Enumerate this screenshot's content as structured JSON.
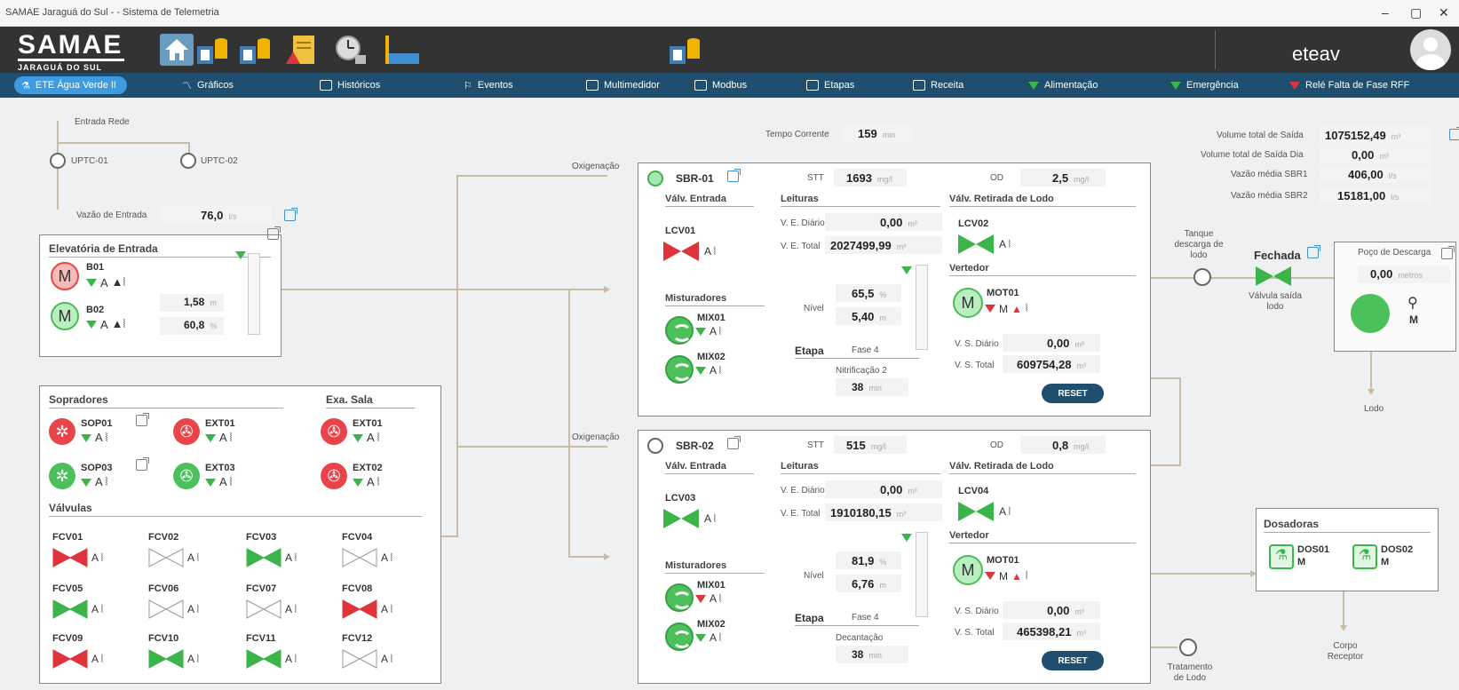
{
  "window": {
    "title": "SAMAE Jaraguá do Sul - - Sistema de Telemetria",
    "min": "–",
    "max": "▢",
    "close": "✕"
  },
  "header": {
    "logo_line1": "SAMAE",
    "logo_line2": "JARAGUÁ DO SUL",
    "user": "eteav"
  },
  "nav": {
    "items": [
      "ETE Água Verde II",
      "Gráficos",
      "Históricos",
      "Eventos",
      "Multimedidor",
      "Modbus",
      "Etapas",
      "Receita",
      "Alimentação",
      "Emergência",
      "Relé Falta de Fase RFF"
    ]
  },
  "inlet": {
    "entrada_rede": "Entrada Rede",
    "uptc01": "UPTC-01",
    "uptc02": "UPTC-02",
    "vazao_label": "Vazão de Entrada",
    "vazao_value": "76,0",
    "vazao_unit": "l/s"
  },
  "elevatoria": {
    "title": "Elevatória de Entrada",
    "b01": "B01",
    "b02": "B02",
    "nivel_value": "1,58",
    "nivel_unit": "m",
    "pct_value": "60,8",
    "pct_unit": "%",
    "motor": "M",
    "a": "A"
  },
  "sopradores": {
    "title": "Sopradores",
    "exa_title": "Exa. Sala",
    "sop01": "SOP01",
    "sop03": "SOP03",
    "ext01": "EXT01",
    "ext03": "EXT03",
    "sala_ext01": "EXT01",
    "sala_ext02": "EXT02",
    "valvulas": "Válvulas",
    "fcv": [
      "FCV01",
      "FCV02",
      "FCV03",
      "FCV04",
      "FCV05",
      "FCV06",
      "FCV07",
      "FCV08",
      "FCV09",
      "FCV10",
      "FCV11",
      "FCV12"
    ],
    "fcv_state": [
      "red",
      "off",
      "green",
      "off",
      "green",
      "off",
      "off",
      "red",
      "red",
      "green",
      "green",
      "off"
    ]
  },
  "oxi": {
    "label1": "Oxigenação",
    "label2": "Oxigenação"
  },
  "tempo": {
    "label": "Tempo Corrente",
    "value": "159",
    "unit": "min"
  },
  "sbr1": {
    "name": "SBR-01",
    "stt_label": "STT",
    "stt_value": "1693",
    "stt_unit": "mg/l",
    "od_label": "OD",
    "od_value": "2,5",
    "od_unit": "mg/l",
    "valv_entrada": "Válv. Entrada",
    "valve_tag": "LCV01",
    "leituras": "Leituras",
    "ve_diario_label": "V. E. Diário",
    "ve_diario": "0,00",
    "ve_total_label": "V. E. Total",
    "ve_total": "2027499,99",
    "m3": "m³",
    "retirada": "Válv. Retirada de Lodo",
    "retirada_tag": "LCV02",
    "vertedor": "Vertedor",
    "mot": "MOT01",
    "misturadores": "Misturadores",
    "mix1": "MIX01",
    "mix2": "MIX02",
    "nivel_label": "Nível",
    "nivel_pct": "65,5",
    "nivel_m": "5,40",
    "etapa_label": "Etapa",
    "etapa": "Fase 4",
    "fase_desc": "Nitrificação 2",
    "fase_min": "38",
    "min": "min",
    "vs_diario_label": "V. S. Diário",
    "vs_diario": "0,00",
    "vs_total_label": "V. S. Total",
    "vs_total": "609754,28",
    "reset": "RESET"
  },
  "sbr2": {
    "name": "SBR-02",
    "stt_label": "STT",
    "stt_value": "515",
    "stt_unit": "mg/l",
    "od_label": "OD",
    "od_value": "0,8",
    "od_unit": "mg/l",
    "valv_entrada": "Válv. Entrada",
    "valve_tag": "LCV03",
    "leituras": "Leituras",
    "ve_diario_label": "V. E. Diário",
    "ve_diario": "0,00",
    "ve_total_label": "V. E. Total",
    "ve_total": "1910180,15",
    "m3": "m³",
    "retirada": "Válv. Retirada de Lodo",
    "retirada_tag": "LCV04",
    "vertedor": "Vertedor",
    "mot": "MOT01",
    "misturadores": "Misturadores",
    "mix1": "MIX01",
    "mix2": "MIX02",
    "nivel_label": "Nível",
    "nivel_pct": "81,9",
    "nivel_m": "6,76",
    "etapa_label": "Etapa",
    "etapa": "Fase 4",
    "fase_desc": "Decantação",
    "fase_min": "38",
    "min": "min",
    "vs_diario_label": "V. S. Diário",
    "vs_diario": "0,00",
    "vs_total_label": "V. S. Total",
    "vs_total": "465398,21",
    "reset": "RESET"
  },
  "totals": {
    "vol_saida_label": "Volume total de Saída",
    "vol_saida": "1075152,49",
    "vol_dia_label": "Volume total de Saída Dia",
    "vol_dia": "0,00",
    "m3": "m³",
    "vm1_label": "Vazão média SBR1",
    "vm1": "406,00",
    "vm2_label": "Vazão média SBR2",
    "vm2": "15181,00",
    "ls": "l/s"
  },
  "lodo": {
    "tanque": "Tanque descarga de lodo",
    "fechada": "Fechada",
    "valvula_saida": "Válvula saída lodo",
    "poco_title": "Poço de Descarga",
    "poco_value": "0,00",
    "poco_unit": "metros",
    "m": "M",
    "lodo": "Lodo",
    "tratamento": "Tratamento de Lodo"
  },
  "dosadoras": {
    "title": "Dosadoras",
    "dos01": "DOS01",
    "dos02": "DOS02",
    "m": "M",
    "corpo": "Corpo Receptor"
  }
}
